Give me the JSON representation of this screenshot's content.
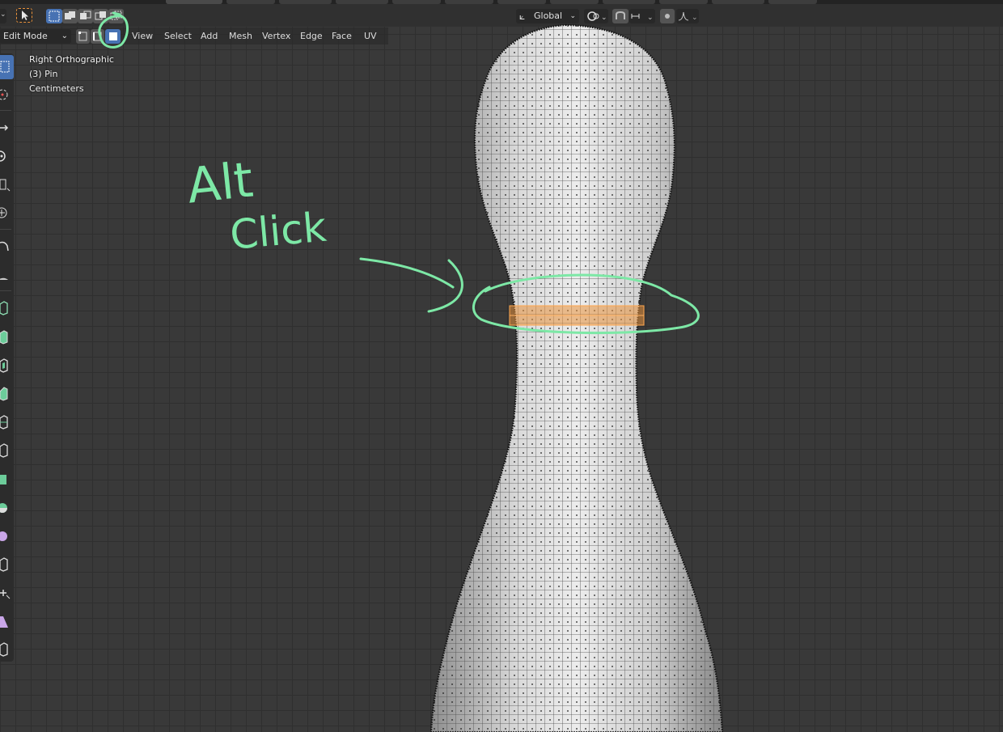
{
  "header": {
    "orientation": "Global",
    "mode": "Edit Mode",
    "menus": [
      "View",
      "Select",
      "Add",
      "Mesh",
      "Vertex",
      "Edge",
      "Face",
      "UV"
    ]
  },
  "viewport": {
    "view_name": "Right Orthographic",
    "object_name": "(3) Pin",
    "units": "Centimeters"
  },
  "annotation": {
    "line1": "Alt",
    "line2": "Click",
    "color": "#7de8a6"
  },
  "selection": {
    "type": "edge-loop",
    "color": "#e8923c"
  },
  "icons": {
    "select-tool": "cursor-arrow",
    "select-modes": [
      "vertex-select",
      "edge-select",
      "face-select"
    ],
    "toolbar": [
      "select-box",
      "cursor",
      "move",
      "rotate",
      "scale",
      "transform",
      "annotate",
      "measure",
      "add-cube",
      "extrude",
      "inset",
      "bevel",
      "loop-cut",
      "knife",
      "poly-build",
      "spin",
      "smooth",
      "edge-slide",
      "shrink-fatten",
      "shear",
      "rip"
    ]
  }
}
